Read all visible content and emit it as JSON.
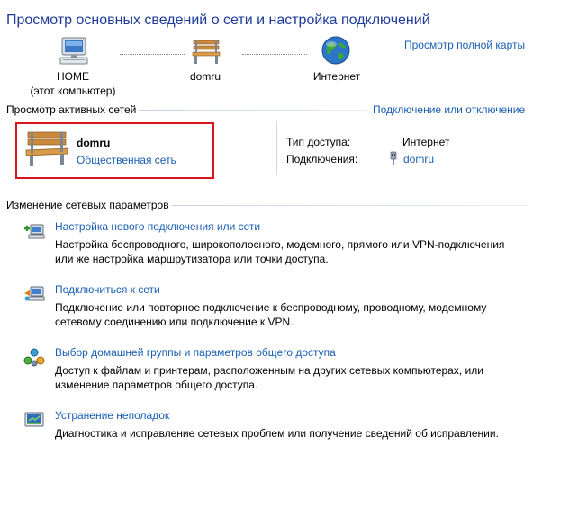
{
  "header": {
    "title": "Просмотр основных сведений о сети и настройка подключений",
    "full_map_link": "Просмотр полной карты"
  },
  "map": {
    "computer_name": "HOME",
    "computer_subtitle": "(этот компьютер)",
    "network_name": "domru",
    "internet_label": "Интернет"
  },
  "active_networks": {
    "header": "Просмотр активных сетей",
    "connect_link": "Подключение или отключение",
    "network": {
      "name": "domru",
      "type_link": "Общественная сеть"
    },
    "access_type_label": "Тип доступа:",
    "access_type_value": "Интернет",
    "connections_label": "Подключения:",
    "connection_value": "domru"
  },
  "change_settings": {
    "header": "Изменение сетевых параметров",
    "tasks": [
      {
        "title": "Настройка нового подключения или сети",
        "desc1": "Настройка беспроводного, широкополосного, модемного, прямого или VPN-подключения",
        "desc2": "или же настройка маршрутизатора или точки доступа."
      },
      {
        "title": "Подключиться к сети",
        "desc1": "Подключение или повторное подключение к беспроводному, проводному, модемному",
        "desc2": "сетевому соединению или подключение к VPN."
      },
      {
        "title": "Выбор домашней группы и параметров общего доступа",
        "desc1": "Доступ к файлам и принтерам, расположенным на других сетевых компьютерах, или",
        "desc2": "изменение параметров общего доступа."
      },
      {
        "title": "Устранение неполадок",
        "desc1": "Диагностика и исправление сетевых проблем или получение сведений об исправлении.",
        "desc2": ""
      }
    ]
  }
}
